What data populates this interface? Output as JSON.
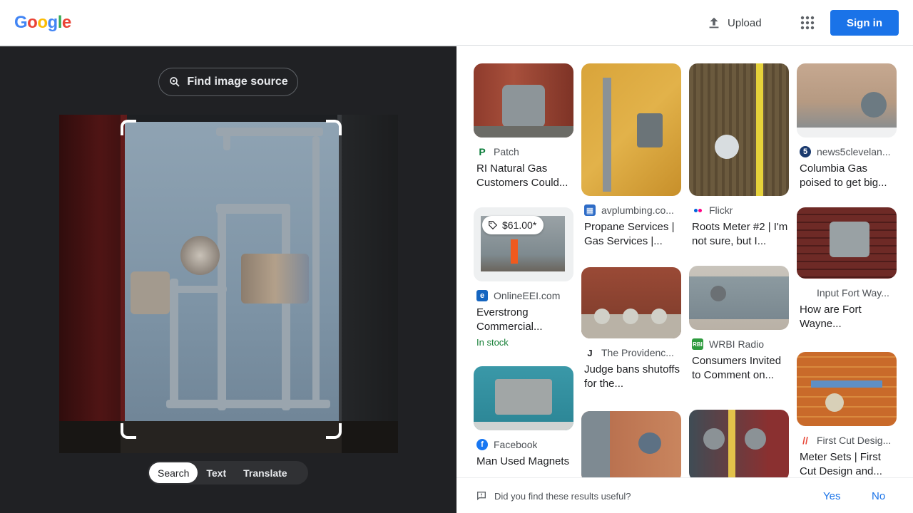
{
  "header": {
    "logo": "Google",
    "upload_label": "Upload",
    "signin_label": "Sign in"
  },
  "lens": {
    "find_source_label": "Find image source",
    "modes": [
      "Search",
      "Text",
      "Translate"
    ],
    "active_mode": "Search"
  },
  "results": [
    {
      "source": "Patch",
      "title": "RI Natural Gas Customers Could...",
      "icon": "patch-icon",
      "icon_color": "#0a7c3a"
    },
    {
      "source": "OnlineEEI.com",
      "title": "Everstrong Commercial...",
      "price": "$61.00*",
      "stock": "In stock",
      "icon": "onlineeei-icon",
      "icon_color": "#1565c0"
    },
    {
      "source": "Facebook",
      "title": "Man Used Magnets",
      "icon": "facebook-icon",
      "icon_color": "#1877f2"
    },
    {
      "source": "avplumbing.co...",
      "title": "Propane Services | Gas Services |...",
      "icon": "avplumbing-icon",
      "icon_color": "#2e6cc7"
    },
    {
      "source": "The Providenc...",
      "title": "Judge bans shutoffs for the...",
      "icon": "providence-icon",
      "icon_color": "#202124"
    },
    {
      "source": "Flickr",
      "title": "Roots Meter #2 | I'm not sure, but I...",
      "icon": "flickr-icon",
      "icon_color": "#ff0084"
    },
    {
      "source": "WRBI Radio",
      "title": "Consumers Invited to Comment on...",
      "icon": "wrbi-icon",
      "icon_color": "#2e9b3e"
    },
    {
      "source": "news5clevelan...",
      "title": "Columbia Gas poised to get big...",
      "icon": "news5-icon",
      "icon_color": "#1a3a6e"
    },
    {
      "source": "Input Fort Way...",
      "title": "How are Fort Wayne...",
      "icon": "inputfw-icon",
      "icon_color": "#ffffff"
    },
    {
      "source": "First Cut Desig...",
      "title": "Meter Sets | First Cut Design and...",
      "icon": "firstcut-icon",
      "icon_color": "#e84c3d"
    }
  ],
  "feedback": {
    "question": "Did you find these results useful?",
    "yes": "Yes",
    "no": "No"
  }
}
